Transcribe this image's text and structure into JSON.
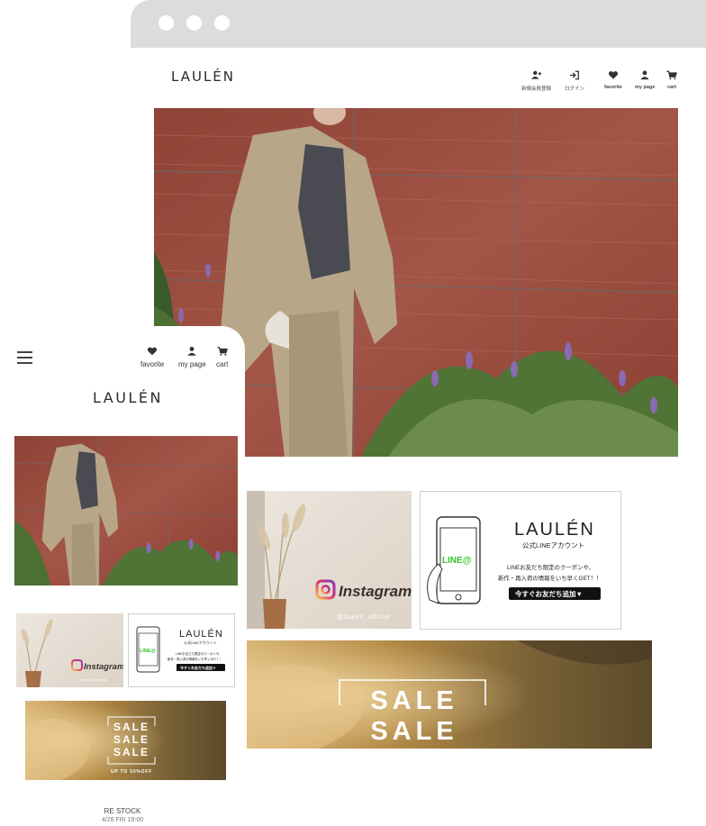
{
  "desktop": {
    "logo": "LAULÉN",
    "nav": [
      {
        "label": "新規会員登録",
        "icon": "user-plus-icon"
      },
      {
        "label": "ログイン",
        "icon": "login-icon"
      },
      {
        "label": "favorite",
        "icon": "heart-icon"
      },
      {
        "label": "my page",
        "icon": "user-icon"
      },
      {
        "label": "cart",
        "icon": "cart-icon"
      }
    ]
  },
  "mobile": {
    "logo": "LAULÉN",
    "nav": [
      {
        "label": "favorite",
        "icon": "heart-icon"
      },
      {
        "label": "my page",
        "icon": "user-icon"
      },
      {
        "label": "cart",
        "icon": "cart-icon"
      }
    ],
    "restock_title": "RE STOCK",
    "restock_date": "4/26 FRI 19:00"
  },
  "banners": {
    "instagram_label": "Instagram",
    "instagram_handle": "@laulen_official",
    "line_brand": "LAULÉN",
    "line_account": "公式LINEアカウント",
    "line_badge": "LINE@",
    "line_text_1": "LINEお友だち限定のクーポンや、",
    "line_text_2": "新作・再入荷の情報をいち早くGET！！",
    "line_button": "今すぐお友だち追加▼",
    "sale_word": "SALE",
    "sale_mobile_offer": "UP TO 50%OFF"
  },
  "colors": {
    "marble": "#9a4a3c",
    "coat": "#b7a586",
    "line_green": "#36c42f",
    "sale_gold": "#c9a45e"
  }
}
